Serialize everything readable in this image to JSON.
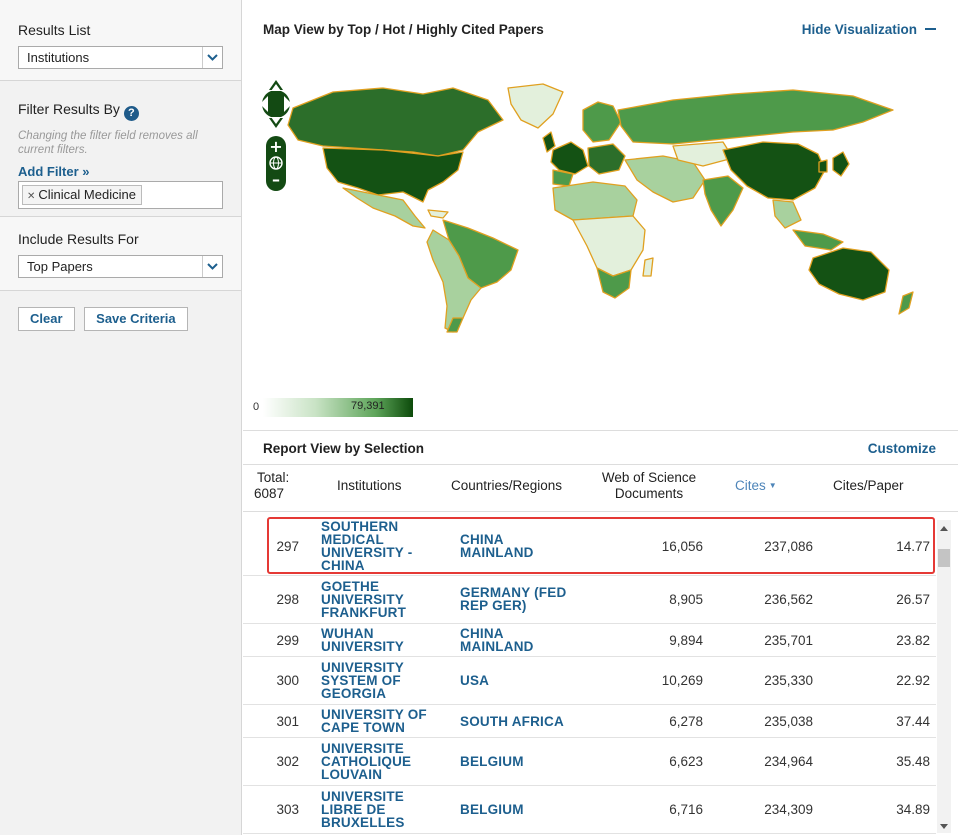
{
  "sidebar": {
    "results_list_title": "Results List",
    "results_list_value": "Institutions",
    "filter_title": "Filter Results By",
    "filter_hint": "Changing the filter field removes all current filters.",
    "add_filter": "Add Filter »",
    "filter_chip": "Clinical Medicine",
    "include_title": "Include Results For",
    "include_value": "Top Papers",
    "clear_button": "Clear",
    "save_button": "Save Criteria"
  },
  "map": {
    "header": "Map View by Top / Hot / Highly Cited Papers",
    "hide_label": "Hide Visualization",
    "legend_min": "0",
    "legend_max": "79,391",
    "colors": {
      "dark": "#145214",
      "mid": "#4e9a4a",
      "light": "#a8d19e",
      "pale": "#e3f0dc",
      "border": "#e0a020"
    }
  },
  "report": {
    "title": "Report View by Selection",
    "customize": "Customize",
    "total_label": "Total:",
    "total_value": "6087",
    "col_institutions": "Institutions",
    "col_countries": "Countries/Regions",
    "col_docs": "Web of Science Documents",
    "col_cites": "Cites",
    "col_cpp": "Cites/Paper",
    "rows": [
      {
        "rank": "297",
        "institution": "SOUTHERN MEDICAL UNIVERSITY - CHINA",
        "country": "CHINA MAINLAND",
        "docs": "16,056",
        "cites": "237,086",
        "cpp": "14.77"
      },
      {
        "rank": "298",
        "institution": "GOETHE UNIVERSITY FRANKFURT",
        "country": "GERMANY (FED REP GER)",
        "docs": "8,905",
        "cites": "236,562",
        "cpp": "26.57"
      },
      {
        "rank": "299",
        "institution": "WUHAN UNIVERSITY",
        "country": "CHINA MAINLAND",
        "docs": "9,894",
        "cites": "235,701",
        "cpp": "23.82"
      },
      {
        "rank": "300",
        "institution": "UNIVERSITY SYSTEM OF GEORGIA",
        "country": "USA",
        "docs": "10,269",
        "cites": "235,330",
        "cpp": "22.92"
      },
      {
        "rank": "301",
        "institution": "UNIVERSITY OF CAPE TOWN",
        "country": "SOUTH AFRICA",
        "docs": "6,278",
        "cites": "235,038",
        "cpp": "37.44"
      },
      {
        "rank": "302",
        "institution": "UNIVERSITE CATHOLIQUE LOUVAIN",
        "country": "BELGIUM",
        "docs": "6,623",
        "cites": "234,964",
        "cpp": "35.48"
      },
      {
        "rank": "303",
        "institution": "UNIVERSITE LIBRE DE BRUXELLES",
        "country": "BELGIUM",
        "docs": "6,716",
        "cites": "234,309",
        "cpp": "34.89"
      }
    ]
  }
}
